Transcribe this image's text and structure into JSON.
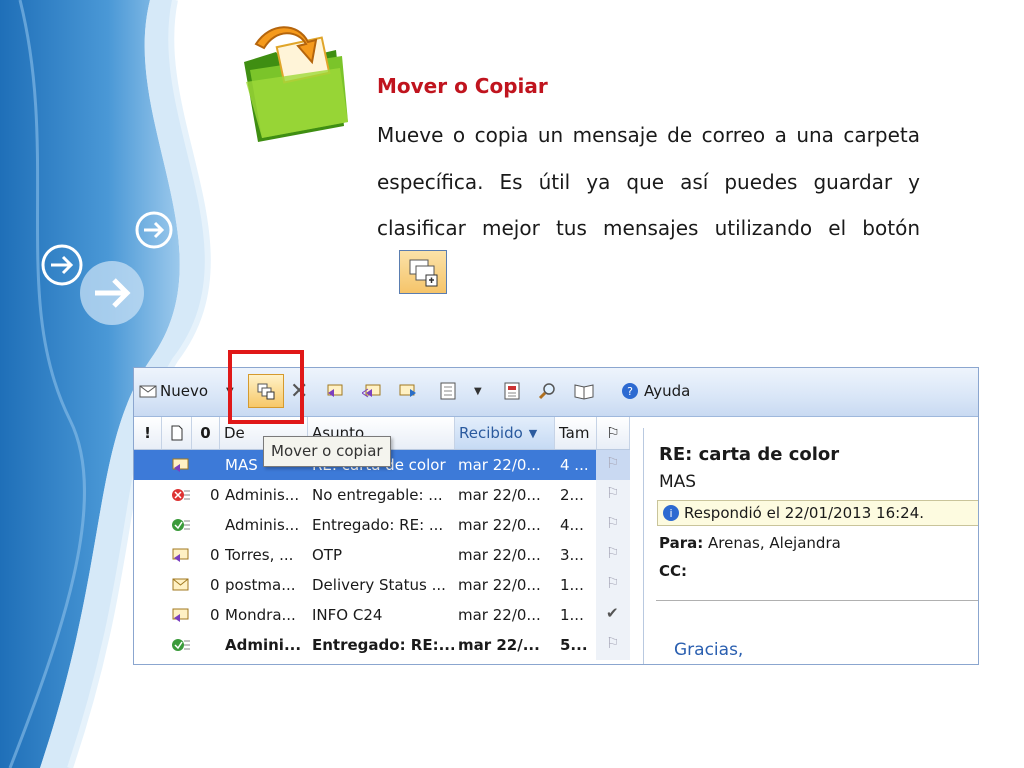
{
  "slide": {
    "title": "Mover o Copiar",
    "body": "Mueve  o copia un mensaje de correo a una carpeta específica. Es útil ya que así puedes guardar y clasificar mejor tus mensajes utilizando el botón",
    "colors": {
      "title": "#c0141e",
      "band": "#2f7fc4"
    }
  },
  "toolbar": {
    "nuevo_label": "Nuevo",
    "ayuda_label": "Ayuda",
    "icons": [
      "new-message-icon",
      "dropdown-arrow-icon",
      "move-copy-icon",
      "delete-icon",
      "reply-icon",
      "reply-all-icon",
      "forward-icon",
      "view-icon",
      "dropdown-arrow-icon",
      "address-book-icon",
      "find-icon",
      "book-icon",
      "help-icon"
    ]
  },
  "tooltip": {
    "text": "Mover o copiar"
  },
  "list": {
    "headers": {
      "importance": "!",
      "type": "",
      "attachment": "",
      "from": "De",
      "subject": "Asunto",
      "received": "Recibido",
      "size": "Tam",
      "flag": ""
    },
    "rows": [
      {
        "from": "MAS",
        "subject": "RE: carta de color",
        "received": "mar 22/0...",
        "size": "4 ...",
        "attachment": false,
        "flagged": false,
        "selected": true,
        "bold": false,
        "icon": "replied-envelope-icon"
      },
      {
        "from": "Adminis...",
        "subject": "No entregable: ...",
        "received": "mar 22/0...",
        "size": "2...",
        "attachment": true,
        "flagged": false,
        "selected": false,
        "bold": false,
        "icon": "undeliverable-icon"
      },
      {
        "from": "Adminis...",
        "subject": "Entregado: RE: ...",
        "received": "mar 22/0...",
        "size": "4...",
        "attachment": false,
        "flagged": false,
        "selected": false,
        "bold": false,
        "icon": "delivered-icon"
      },
      {
        "from": "Torres, ...",
        "subject": "OTP",
        "received": "mar 22/0...",
        "size": "3...",
        "attachment": true,
        "flagged": false,
        "selected": false,
        "bold": false,
        "icon": "replied-envelope-icon"
      },
      {
        "from": "postma...",
        "subject": "Delivery Status ...",
        "received": "mar 22/0...",
        "size": "1...",
        "attachment": true,
        "flagged": false,
        "selected": false,
        "bold": false,
        "icon": "envelope-icon"
      },
      {
        "from": "Mondra...",
        "subject": "INFO C24",
        "received": "mar 22/0...",
        "size": "1...",
        "attachment": true,
        "flagged": true,
        "selected": false,
        "bold": false,
        "icon": "replied-envelope-icon"
      },
      {
        "from": "Admini...",
        "subject": "Entregado: RE:...",
        "received": "mar 22/...",
        "size": "5...",
        "attachment": false,
        "flagged": false,
        "selected": false,
        "bold": true,
        "icon": "delivered-icon"
      }
    ]
  },
  "reading": {
    "subject": "RE: carta de color",
    "sender": "MAS",
    "info": "Respondió el 22/01/2013 16:24.",
    "para_label": "Para:",
    "para_value": "Arenas, Alejandra",
    "cc_label": "CC:",
    "body": "Gracias,"
  }
}
